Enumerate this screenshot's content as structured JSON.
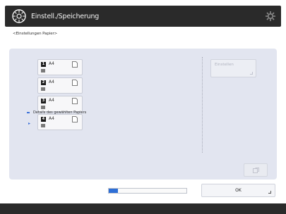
{
  "header": {
    "title": "Einstell./Speicherung",
    "logo_icon": "settings-registration-icon",
    "gear_icon": "gear-icon"
  },
  "subtitle": "<Einstellungen Papier>",
  "drawers": [
    {
      "number": "1",
      "size": "A4"
    },
    {
      "number": "2",
      "size": "A4"
    },
    {
      "number": "3",
      "size": "A4"
    },
    {
      "number": "4",
      "size": "A4"
    }
  ],
  "settings_button": {
    "label": "Einstellen"
  },
  "detail": {
    "text": "Details des gewählten Papiers",
    "arrow": "▸"
  },
  "progress": {
    "value": 0.12
  },
  "ok_button": {
    "label": "OK"
  },
  "colors": {
    "accent": "#2e6fd6",
    "header_bg": "#2a2a2a",
    "panel_bg": "#e2e5f0"
  }
}
